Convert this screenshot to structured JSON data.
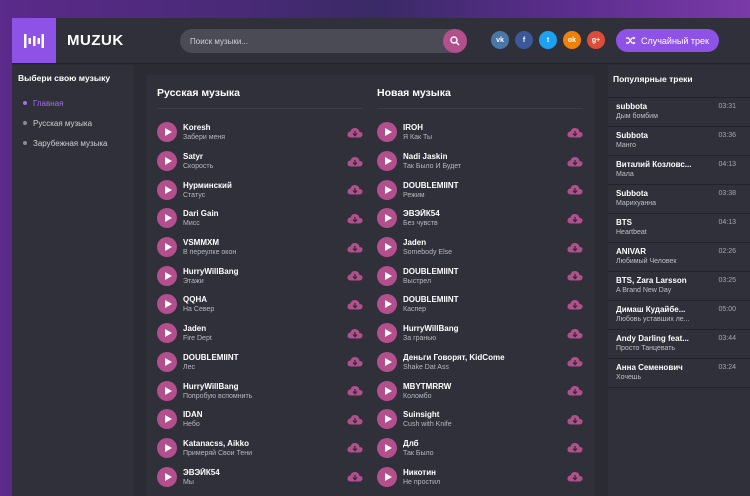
{
  "brand": "MUZUK",
  "search": {
    "placeholder": "Поиск музыки..."
  },
  "random_button": "Случайный трек",
  "socials": [
    {
      "name": "vk-icon",
      "label": "vk",
      "color": "#4a76a8"
    },
    {
      "name": "facebook-icon",
      "label": "f",
      "color": "#3b5998"
    },
    {
      "name": "twitter-icon",
      "label": "t",
      "color": "#1da1f2"
    },
    {
      "name": "odnoklassniki-icon",
      "label": "ok",
      "color": "#ee8208"
    },
    {
      "name": "google-plus-icon",
      "label": "g+",
      "color": "#dd4b39"
    }
  ],
  "colors": {
    "accent": "#8e52e6",
    "play": "#b24f8c"
  },
  "sidebar": {
    "title": "Выбери свою музыку",
    "items": [
      {
        "label": "Главная",
        "active": true
      },
      {
        "label": "Русская музыка",
        "active": false
      },
      {
        "label": "Зарубежная музыка",
        "active": false
      }
    ]
  },
  "russian": {
    "title": "Русская музыка",
    "tracks": [
      {
        "artist": "Koresh",
        "title": "Забери меня"
      },
      {
        "artist": "Satyr",
        "title": "Скорость"
      },
      {
        "artist": "Нурминский",
        "title": "Статус"
      },
      {
        "artist": "Dari Gain",
        "title": "Мисс"
      },
      {
        "artist": "VSMMXM",
        "title": "В переулке окон"
      },
      {
        "artist": "HurryWillBang",
        "title": "Этажи"
      },
      {
        "artist": "QQHA",
        "title": "На Север"
      },
      {
        "artist": "Jaden",
        "title": "Fire Dept"
      },
      {
        "artist": "DOUBLEMIINT",
        "title": "Лес"
      },
      {
        "artist": "HurryWillBang",
        "title": "Попробую вспомнить"
      },
      {
        "artist": "IDAN",
        "title": "Небо"
      },
      {
        "artist": "Katanacss, Aikko",
        "title": "Примеряй Свои Тени"
      },
      {
        "artist": "ЭВЭЙК54",
        "title": "Мы"
      }
    ]
  },
  "new": {
    "title": "Новая музыка",
    "tracks": [
      {
        "artist": "IROH",
        "title": "Я Как Ты"
      },
      {
        "artist": "Nadi Jaskin",
        "title": "Так Было И Будет"
      },
      {
        "artist": "DOUBLEMIINT",
        "title": "Режим"
      },
      {
        "artist": "ЭВЭЙК54",
        "title": "Без чувств"
      },
      {
        "artist": "Jaden",
        "title": "Somebody Else"
      },
      {
        "artist": "DOUBLEMIINT",
        "title": "Выстрел"
      },
      {
        "artist": "DOUBLEMIINT",
        "title": "Каспер"
      },
      {
        "artist": "HurryWillBang",
        "title": "За гранью"
      },
      {
        "artist": "Деньги Говорят, KidCome",
        "title": "Shake Dat Ass"
      },
      {
        "artist": "MBYTMRRW",
        "title": "Коломбо"
      },
      {
        "artist": "Suinsight",
        "title": "Cush with Knife"
      },
      {
        "artist": "Длб",
        "title": "Так Было"
      },
      {
        "artist": "Никотин",
        "title": "Не простил"
      }
    ]
  },
  "popular": {
    "title": "Популярные треки",
    "tracks": [
      {
        "artist": "subbota",
        "title": "Дым бомбим",
        "time": "03:31"
      },
      {
        "artist": "Subbota",
        "title": "Манго",
        "time": "03:36"
      },
      {
        "artist": "Виталий Козловс...",
        "title": "Мала",
        "time": "04:13"
      },
      {
        "artist": "Subbota",
        "title": "Марихуанна",
        "time": "03:38"
      },
      {
        "artist": "BTS",
        "title": "Heartbeat",
        "time": "04:13"
      },
      {
        "artist": "ANIVAR",
        "title": "Любимый Человек",
        "time": "02:26"
      },
      {
        "artist": "BTS, Zara Larsson",
        "title": "A Brand New Day",
        "time": "03:25"
      },
      {
        "artist": "Димаш Кудайбе...",
        "title": "Любовь уставших ле...",
        "time": "05:00"
      },
      {
        "artist": "Andy Darling feat...",
        "title": "Просто Танцевать",
        "time": "03:44"
      },
      {
        "artist": "Анна Семенович",
        "title": "Хочешь",
        "time": "03:24"
      }
    ]
  }
}
